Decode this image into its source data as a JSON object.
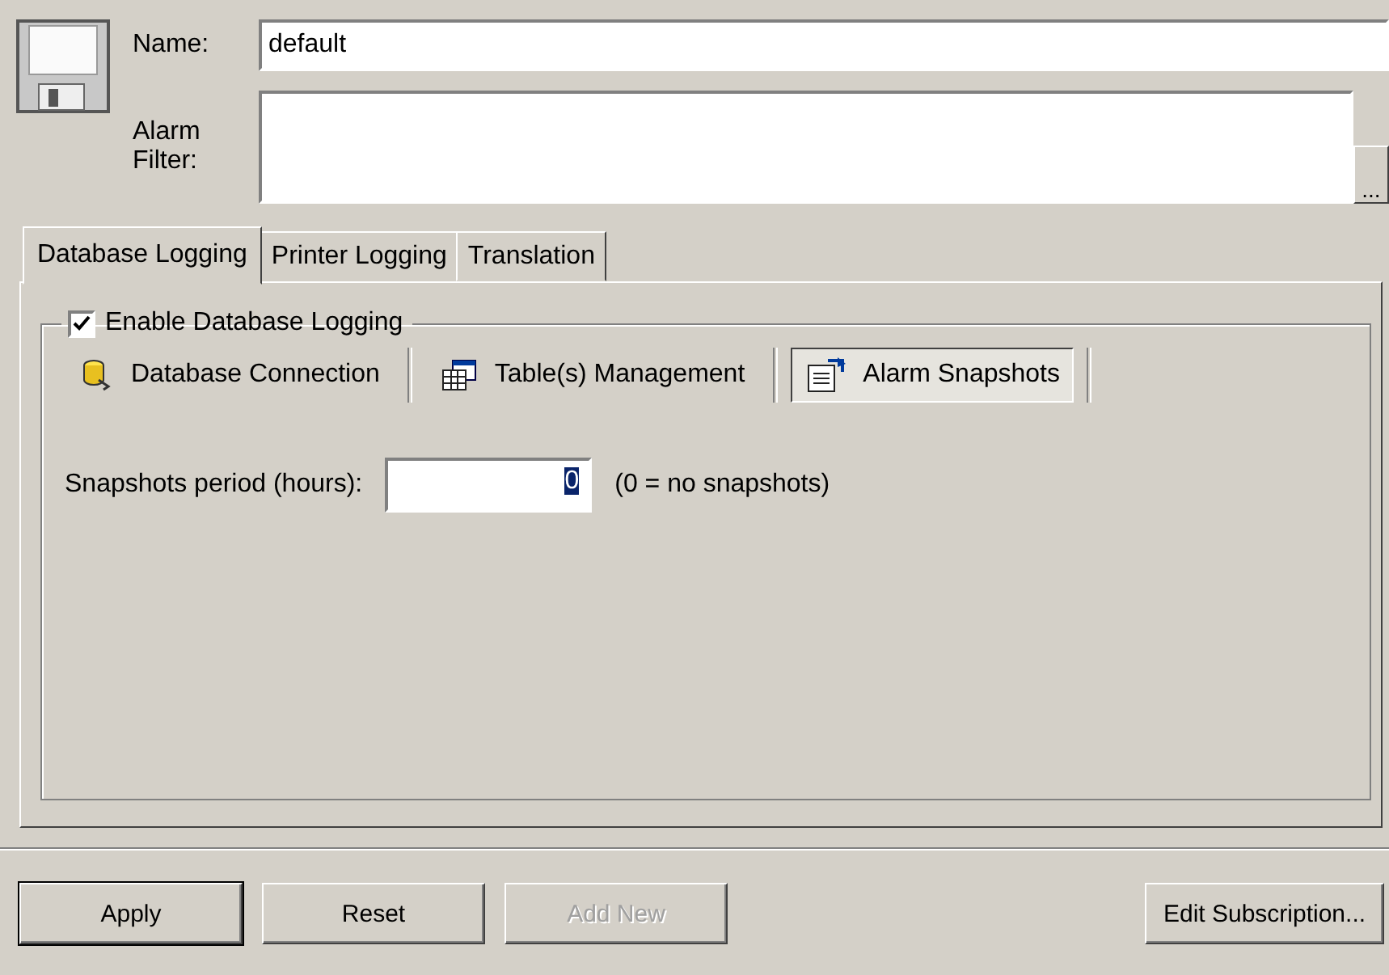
{
  "header": {
    "name_label": "Name:",
    "name_value": "default",
    "filter_label": "Alarm Filter:",
    "filter_button": "..."
  },
  "tabs": [
    {
      "label": "Database Logging",
      "selected": true
    },
    {
      "label": "Printer Logging",
      "selected": false
    },
    {
      "label": "Translation",
      "selected": false
    }
  ],
  "logging": {
    "label": "Enable Database Logging",
    "checked": true
  },
  "subtabs": [
    {
      "label": "Database Connection",
      "kind": "database",
      "selected": false
    },
    {
      "label": "Table(s) Management",
      "kind": "table",
      "selected": false
    },
    {
      "label": "Alarm Snapshots",
      "kind": "snapshot",
      "selected": true
    }
  ],
  "snapshots": {
    "label": "Snapshots period (hours):",
    "value": "0",
    "note": "(0 = no snapshots)"
  },
  "buttons": [
    {
      "label": "Apply",
      "disabled": false,
      "default": true
    },
    {
      "label": "Reset",
      "disabled": false,
      "default": false
    },
    {
      "label": "Add New",
      "disabled": true,
      "default": false
    },
    {
      "label": "Edit Subscription...",
      "disabled": false,
      "default": false
    }
  ]
}
